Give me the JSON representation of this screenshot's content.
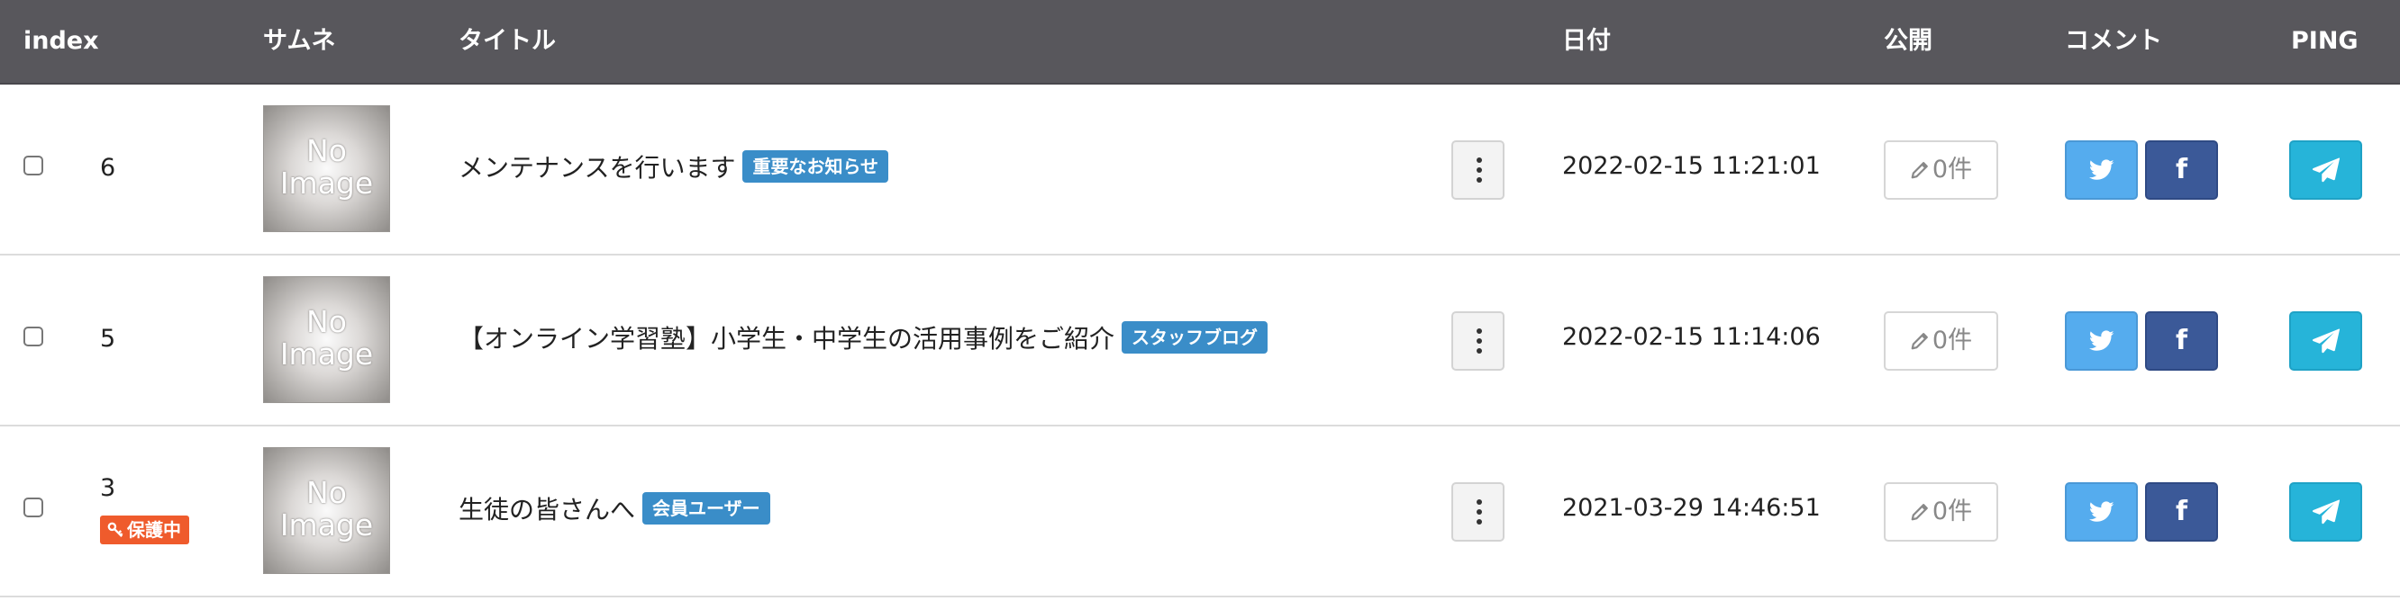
{
  "header": {
    "index": "index",
    "thumb": "サムネ",
    "title": "タイトル",
    "date": "日付",
    "public": "公開",
    "comment": "コメント",
    "ping": "PING"
  },
  "thumbnail": {
    "line1": "No",
    "line2": "Image"
  },
  "rows": [
    {
      "index": "6",
      "title": "メンテナンスを行います",
      "tag": "重要なお知らせ",
      "date": "2022-02-15 11:21:01",
      "public_count": "0件",
      "protected_label": ""
    },
    {
      "index": "5",
      "title": "【オンライン学習塾】小学生・中学生の活用事例をご紹介",
      "tag": "スタッフブログ",
      "date": "2022-02-15 11:14:06",
      "public_count": "0件",
      "protected_label": ""
    },
    {
      "index": "3",
      "title": "生徒の皆さんへ",
      "tag": "会員ユーザー",
      "date": "2021-03-29 14:46:51",
      "public_count": "0件",
      "protected_label": "保護中"
    }
  ],
  "facebook_glyph": "f",
  "icons": {
    "kebab": "vertical-ellipsis-icon",
    "public": "pencil-icon",
    "twitter": "twitter-bird-icon",
    "facebook": "facebook-icon",
    "ping": "paper-plane-icon",
    "protected": "key-icon"
  },
  "colors": {
    "header_bg": "#58575c",
    "tag": "#3a8dc8",
    "protected": "#ef5b2c",
    "twitter": "#55acee",
    "facebook": "#3b5998",
    "ping": "#26b4d9"
  }
}
